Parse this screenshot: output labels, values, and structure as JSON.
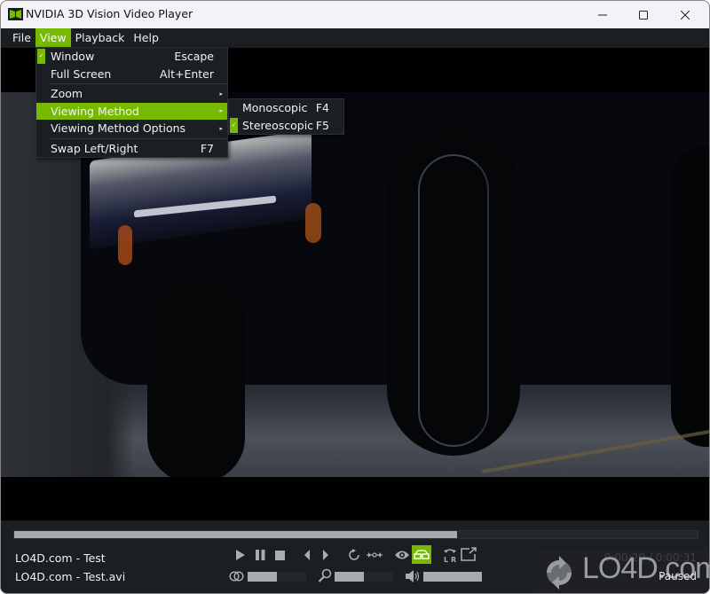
{
  "window": {
    "title": "NVIDIA 3D Vision Video Player",
    "app_icon": "nvidia-3d-vision-icon",
    "controls": {
      "minimize": "minimize-icon",
      "maximize": "maximize-icon",
      "close": "close-icon"
    }
  },
  "colors": {
    "accent": "#76b900",
    "background": "#1b1e22",
    "slider_fill": "#a6abaf",
    "slider_track": "#23272b"
  },
  "menubar": {
    "items": [
      {
        "label": "File",
        "active": false
      },
      {
        "label": "View",
        "active": true
      },
      {
        "label": "Playback",
        "active": false
      },
      {
        "label": "Help",
        "active": false
      }
    ]
  },
  "view_menu": {
    "items": [
      {
        "label": "Window",
        "shortcut": "Escape",
        "checked": true
      },
      {
        "label": "Full Screen",
        "shortcut": "Alt+Enter",
        "checked": false
      },
      {
        "label": "Zoom",
        "submenu": true
      },
      {
        "label": "Viewing Method",
        "submenu": true,
        "highlighted": true
      },
      {
        "label": "Viewing Method Options",
        "submenu": true
      },
      {
        "label": "Swap Left/Right",
        "shortcut": "F7"
      }
    ],
    "submenu_arrow": "▸",
    "check_mark": "✓"
  },
  "viewing_method_submenu": {
    "items": [
      {
        "label": "Monoscopic",
        "shortcut": "F4",
        "checked": false
      },
      {
        "label": "Stereoscopic",
        "shortcut": "F5",
        "checked": true
      }
    ]
  },
  "player": {
    "media_title": "LO4D.com - Test",
    "file_name": "LO4D.com - Test.avi",
    "position": "0:00:20",
    "duration": "0:00:31",
    "time_display": "0:00:20 / 0:00:31",
    "status": "Paused",
    "seek_progress_percent": 64.8,
    "depth_percent": 50,
    "zoom_percent": 50,
    "volume_percent": 100
  },
  "buttons": {
    "play": "play-icon",
    "pause": "pause-icon",
    "stop": "stop-icon",
    "previous_frame": "step-back-icon",
    "next_frame": "step-forward-icon",
    "repeat": "repeat-icon",
    "ab_loop": "ab-loop-icon",
    "eye": "eye-icon",
    "3d_glasses": "3d-glasses-icon",
    "swap_lr": "swap-left-right-icon",
    "fullscreen": "fullscreen-icon",
    "depth": "depth-icon",
    "zoom": "zoom-icon",
    "volume": "volume-icon"
  },
  "watermark": {
    "text": "LO4D.com"
  }
}
